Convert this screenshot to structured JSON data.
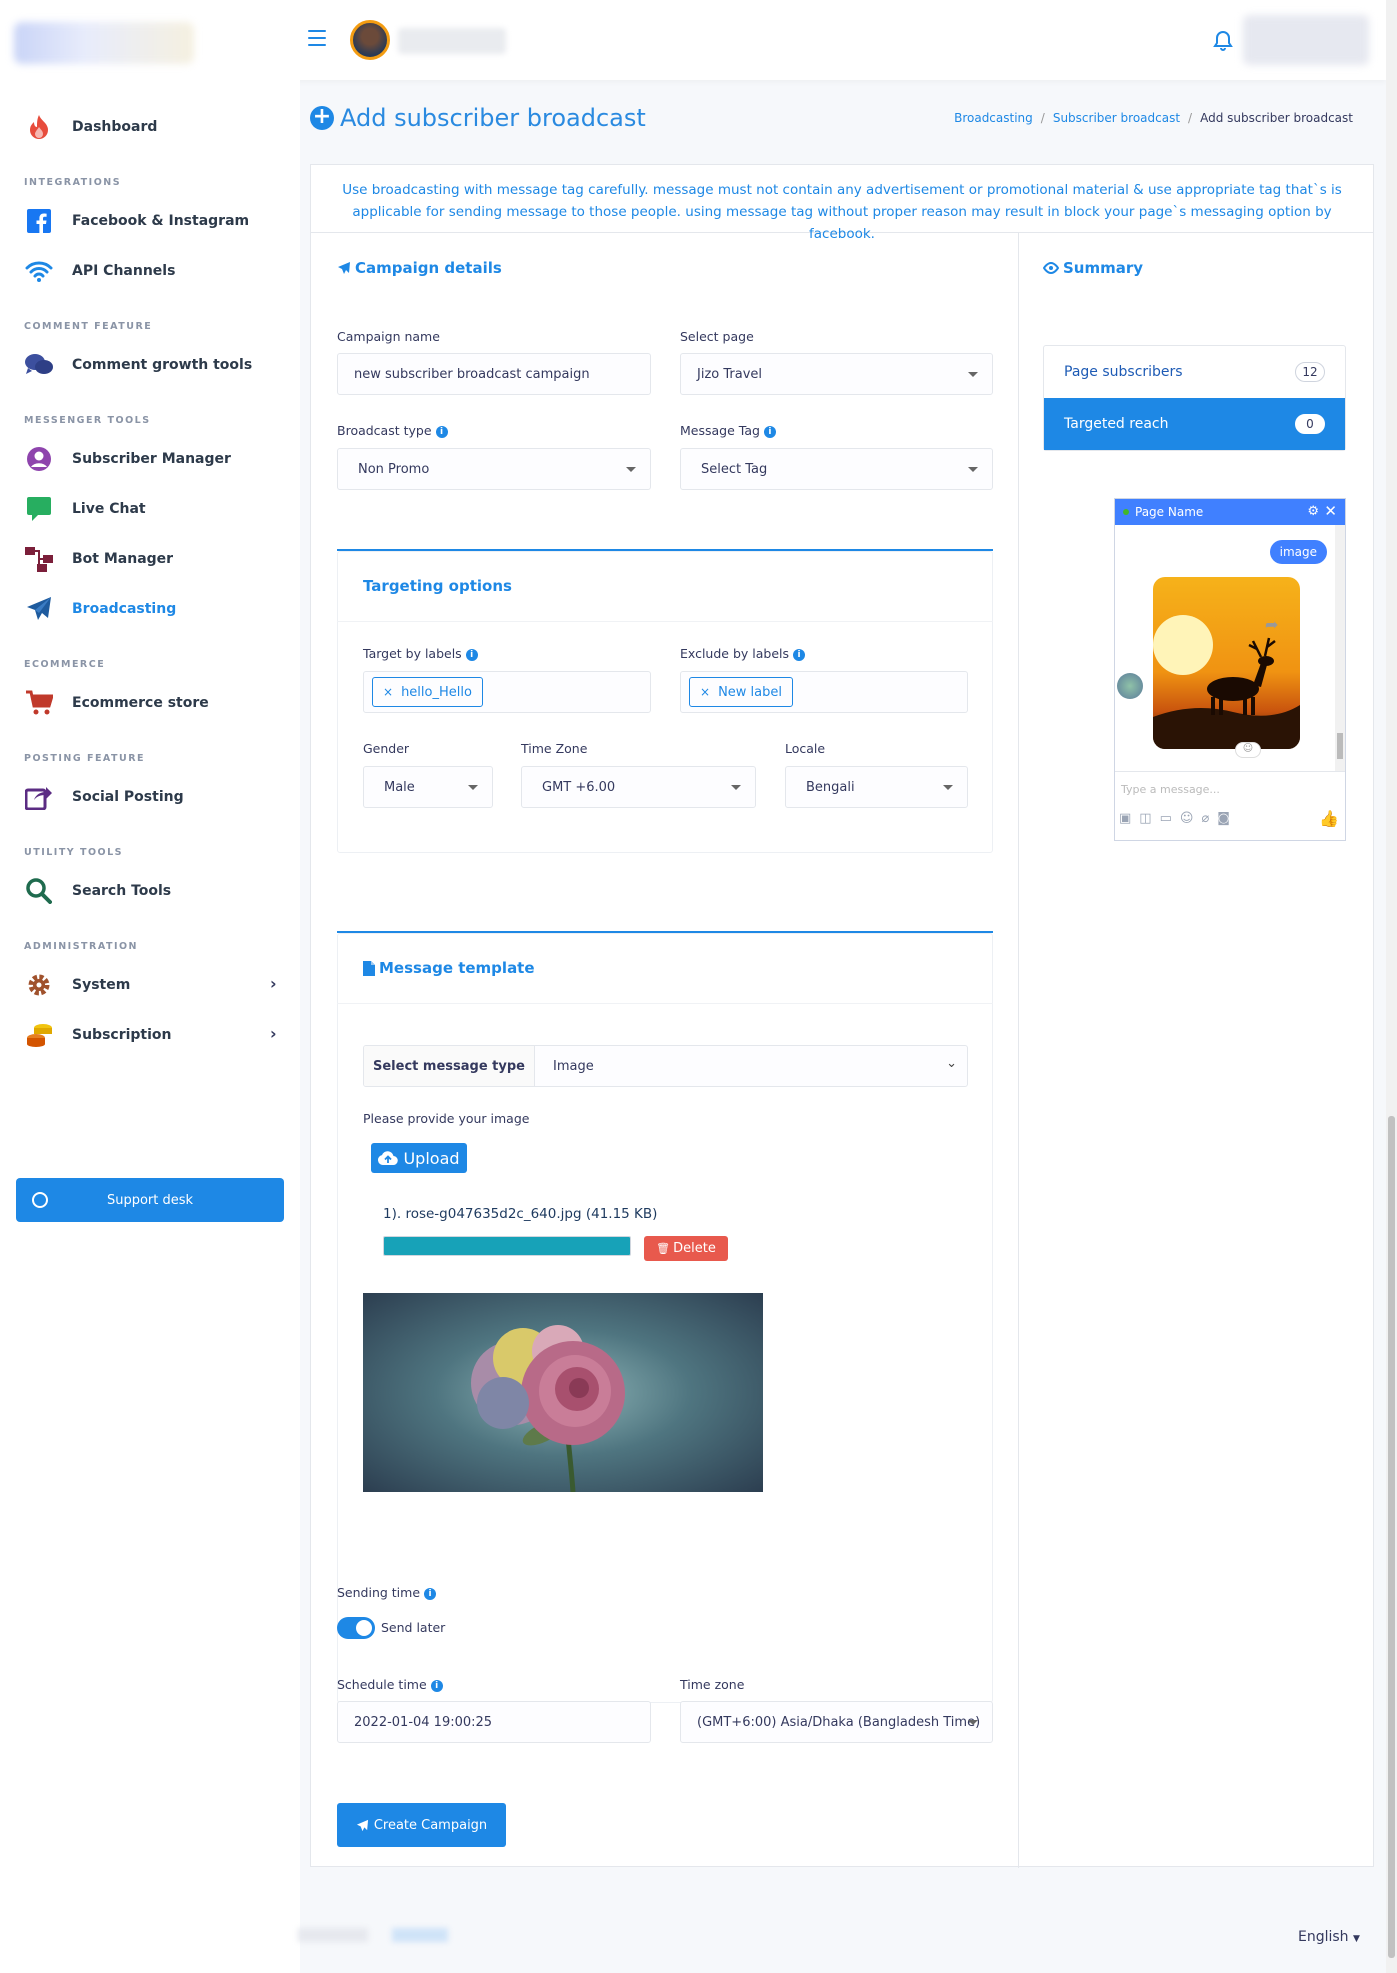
{
  "sidebar": {
    "items": [
      {
        "label": "Dashboard"
      },
      {
        "label": "Facebook & Instagram"
      },
      {
        "label": "API Channels"
      },
      {
        "label": "Comment growth tools"
      },
      {
        "label": "Subscriber Manager"
      },
      {
        "label": "Live Chat"
      },
      {
        "label": "Bot Manager"
      },
      {
        "label": "Broadcasting"
      },
      {
        "label": "Ecommerce store"
      },
      {
        "label": "Social Posting"
      },
      {
        "label": "Search Tools"
      },
      {
        "label": "System"
      },
      {
        "label": "Subscription"
      }
    ],
    "headings": [
      "INTEGRATIONS",
      "COMMENT FEATURE",
      "MESSENGER TOOLS",
      "ECOMMERCE",
      "POSTING FEATURE",
      "UTILITY TOOLS",
      "ADMINISTRATION"
    ],
    "support_label": "Support desk",
    "active_color": "#1e88e5"
  },
  "page": {
    "title": "Add subscriber broadcast",
    "breadcrumb": [
      "Broadcasting",
      "Subscriber broadcast",
      "Add subscriber broadcast"
    ],
    "notice": "Use broadcasting with message tag carefully. message must not contain any advertisement or promotional material & use appropriate tag that`s is applicable for sending message to those people. using message tag without proper reason may result in block your page`s messaging option by facebook."
  },
  "campaign": {
    "title": "Campaign details",
    "name_label": "Campaign name",
    "name_value": "new subscriber broadcast campaign",
    "page_label": "Select page",
    "page_value": "Jizo Travel",
    "type_label": "Broadcast type",
    "type_value": "Non Promo",
    "tag_label": "Message Tag",
    "tag_value": "Select Tag"
  },
  "targeting": {
    "title": "Targeting options",
    "target_label": "Target by labels",
    "target_tag": "hello_Hello",
    "exclude_label": "Exclude by labels",
    "exclude_tag": "New label",
    "gender_label": "Gender",
    "gender_value": "Male",
    "tz_label": "Time Zone",
    "tz_value": "GMT +6.00",
    "locale_label": "Locale",
    "locale_value": "Bengali"
  },
  "template": {
    "title": "Message template",
    "select_type_label": "Select message type",
    "select_type_value": "Image",
    "provide_label": "Please provide your image",
    "upload_label": "Upload",
    "file_name": "1). rose-g047635d2c_640.jpg (41.15 KB)",
    "upload_progress": 1.0,
    "delete_label": "Delete"
  },
  "schedule": {
    "sending_label": "Sending time",
    "send_later_label": "Send later",
    "send_later_on": true,
    "time_label": "Schedule time",
    "time_value": "2022-01-04 19:00:25",
    "zone_label": "Time zone",
    "zone_value": "(GMT+6:00) Asia/Dhaka (Bangladesh Time)",
    "create_label": "Create Campaign"
  },
  "summary": {
    "title": "Summary",
    "rows": [
      {
        "label": "Page subscribers",
        "count": "12"
      },
      {
        "label": "Targeted reach",
        "count": "0"
      }
    ]
  },
  "preview": {
    "page_name": "Page Name",
    "bubble": "image",
    "input_placeholder": "Type a message..."
  },
  "footer": {
    "language": "English"
  }
}
